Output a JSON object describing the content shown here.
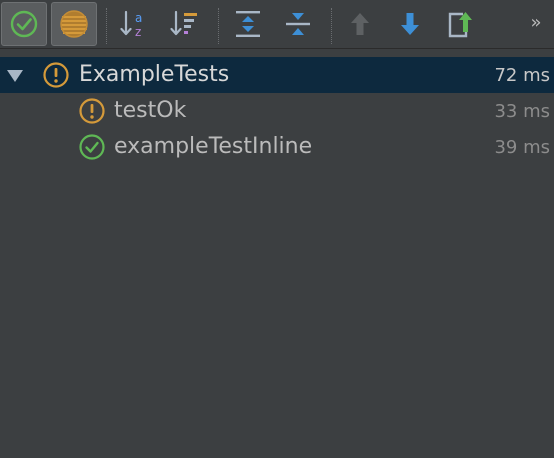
{
  "toolbar": {
    "buttons": [
      {
        "name": "show-passed-icon",
        "toggled": true
      },
      {
        "name": "show-ignored-icon",
        "toggled": true
      },
      {
        "name": "sort-alphabetically-icon",
        "toggled": false
      },
      {
        "name": "sort-by-duration-icon",
        "toggled": false
      },
      {
        "name": "expand-all-icon",
        "toggled": false
      },
      {
        "name": "collapse-all-icon",
        "toggled": false
      },
      {
        "name": "previous-failed-test-icon",
        "toggled": false
      },
      {
        "name": "next-failed-test-icon",
        "toggled": false
      },
      {
        "name": "export-test-results-icon",
        "toggled": false
      }
    ],
    "overflow_label": "»",
    "colors": {
      "passed_green": "#5fb855",
      "warning_orange": "#d59a3a",
      "arrow_blue": "#3d8fd6",
      "arrow_disabled": "#5e6163"
    }
  },
  "tree": {
    "rows": [
      {
        "label": "ExampleTests",
        "time": "72 ms",
        "status": "warning",
        "expanded": true,
        "selected": true
      },
      {
        "label": "testOk",
        "time": "33 ms",
        "status": "warning"
      },
      {
        "label": "exampleTestInline",
        "time": "39 ms",
        "status": "passed"
      }
    ]
  }
}
